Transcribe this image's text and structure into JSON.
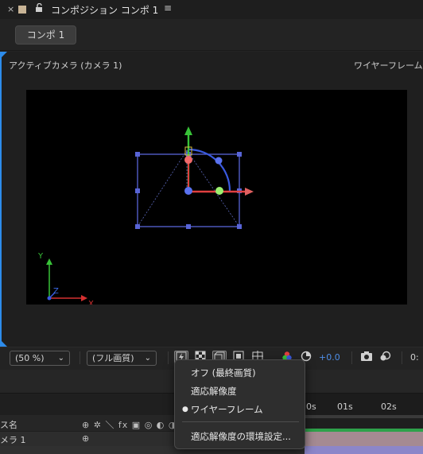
{
  "panel": {
    "close_glyph": "×",
    "lock_glyph": "🔓",
    "title": "コンポジション コンポ 1",
    "menu_glyph": "≡",
    "comp_button": "コンポ 1"
  },
  "viewer": {
    "camera_label": "アクティブカメラ (カメラ 1)",
    "renderer_label": "ワイヤーフレーム",
    "axis_labels": {
      "x": "X",
      "y": "Y",
      "z": "Z"
    }
  },
  "toolbar": {
    "zoom_value": "(50 %)",
    "quality_value": "(フル画質)",
    "chevron": "⌄",
    "exposure_value": "+0.0",
    "time_partial": "0:",
    "icons": [
      "fast-preview-icon",
      "transparency-grid-icon",
      "3d-renderer-icon",
      "mask-visibility-icon",
      "region-of-interest-icon",
      "color-channels-icon",
      "exposure-reset-icon",
      "snapshot-icon",
      "show-snapshot-icon"
    ]
  },
  "timeline": {
    "column_name_partial": "ス名",
    "column_icons": "⊕ ✲ ＼ fx ▣ ◎ ◐ ◑",
    "layer_name_partial": "メラ 1",
    "layer_icon": "⊕",
    "ticks": [
      "0s",
      "01s",
      "02s"
    ]
  },
  "menu": {
    "items": [
      {
        "label": "オフ (最終画質)",
        "selected": false
      },
      {
        "label": "適応解像度",
        "selected": false
      },
      {
        "label": "ワイヤーフレーム",
        "selected": true
      },
      {
        "label": "適応解像度の環境設定...",
        "selected": false
      }
    ],
    "selected_glyph": "●"
  },
  "colors": {
    "accent_blue": "#2d8ceb",
    "wireframe": "#4a5ad8",
    "axis_x": "#e04040",
    "axis_y": "#38c238",
    "axis_z": "#3a5ae0"
  }
}
